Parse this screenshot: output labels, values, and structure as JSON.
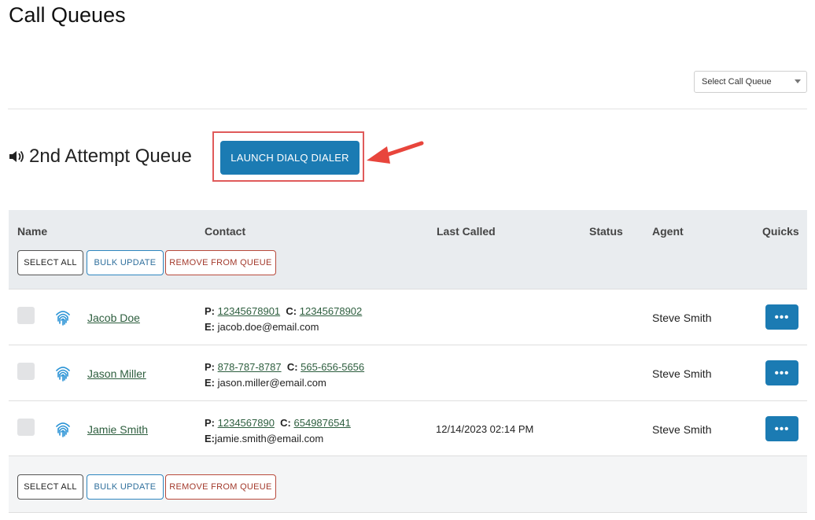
{
  "page": {
    "title": "Call Queues"
  },
  "queue_select": {
    "placeholder": "Select Call Queue"
  },
  "queue": {
    "name": "2nd Attempt Queue",
    "launch_label": "LAUNCH DIALQ DIALER"
  },
  "table": {
    "columns": {
      "name": "Name",
      "contact": "Contact",
      "last_called": "Last Called",
      "status": "Status",
      "agent": "Agent",
      "quicks": "Quicks"
    },
    "actions": {
      "select_all": "SELECT ALL",
      "bulk_update": "BULK UPDATE",
      "remove": "REMOVE FROM QUEUE"
    },
    "rows": [
      {
        "name": "Jacob Doe",
        "p_label": "P:",
        "phone": "12345678901",
        "c_label": "C:",
        "cell": "12345678902",
        "e_label": "E:",
        "email": " jacob.doe@email.com",
        "last_called": "",
        "status": "",
        "agent": "Steve Smith",
        "quick": "•••"
      },
      {
        "name": "Jason Miller",
        "p_label": "P:",
        "phone": "878-787-8787",
        "c_label": "C:",
        "cell": "565-656-5656",
        "e_label": "E:",
        "email": " jason.miller@email.com",
        "last_called": "",
        "status": "",
        "agent": "Steve Smith",
        "quick": "•••"
      },
      {
        "name": "Jamie Smith",
        "p_label": "P:",
        "phone": "1234567890",
        "c_label": "C:",
        "cell": "6549876541",
        "e_label": "E:",
        "email": "jamie.smith@email.com",
        "last_called": "12/14/2023 02:14 PM",
        "status": "",
        "agent": "Steve Smith",
        "quick": "•••"
      }
    ]
  },
  "colors": {
    "primary": "#1b7bb3",
    "highlight": "#e05a5a",
    "link": "#2d5e3e",
    "header_bg": "#e9ecef"
  }
}
